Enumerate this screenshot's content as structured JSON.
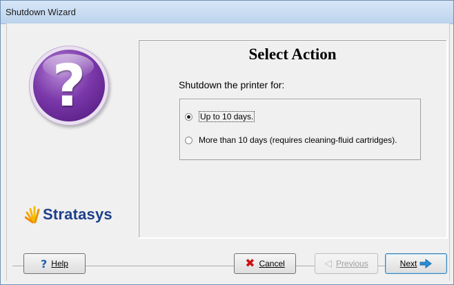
{
  "window": {
    "title": "Shutdown Wizard"
  },
  "sidebar": {
    "brand_name": "Stratasys",
    "help_glyph": "?",
    "icon": "help-question-icon"
  },
  "main": {
    "heading": "Select Action",
    "prompt": "Shutdown the printer for:",
    "options": [
      {
        "label": "Up to 10 days.",
        "selected": true
      },
      {
        "label": "More than 10 days (requires cleaning-fluid cartridges).",
        "selected": false
      }
    ]
  },
  "buttons": {
    "help": {
      "label_prefix": "",
      "label": "Help",
      "icon": "question-mark-icon"
    },
    "cancel": {
      "label": "Cancel",
      "icon": "red-x-icon"
    },
    "previous": {
      "label": "Previous",
      "icon": "back-arrow-icon",
      "enabled": false
    },
    "next": {
      "label": "Next",
      "icon": "forward-arrow-icon"
    }
  },
  "colors": {
    "accent_purple": "#7b38aa",
    "brand_blue": "#1d3f8a",
    "cancel_red": "#cc1111",
    "next_arrow": "#2a8fd6"
  }
}
